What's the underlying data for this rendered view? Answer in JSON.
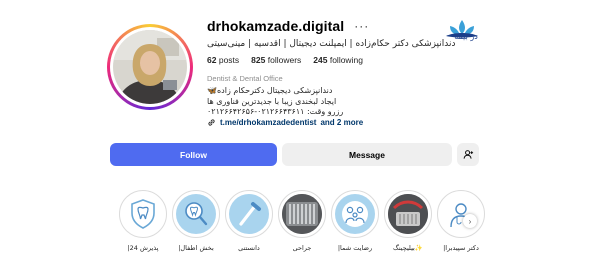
{
  "watermark": {
    "text": "در بیمه"
  },
  "profile": {
    "username": "drhokamzade.digital",
    "more_label": "···",
    "fullname": "دندانپزشکی دکتر حکام‌زاده | ایمپلنت دیجیتال | اقدسیه | مینی‌سیتی",
    "stats": {
      "posts_count": "62",
      "posts_label": "posts",
      "followers_count": "825",
      "followers_label": "followers",
      "following_count": "245",
      "following_label": "following"
    },
    "category": "Dentist & Dental Office",
    "bio_lines": [
      "دندانپزشکی دیجیتال دکترحکام زاده🦋",
      "ایجاد لبخندی زیبا با جدیدترین فناوری ها",
      "رزرو وقت: ۰۲۱۲۶۶۴۳۶۱۱-۰۲۱۲۶۶۴۲۶۵۶"
    ],
    "link_text": "t.me/drhokamzadedentist",
    "link_more": "and 2 more"
  },
  "actions": {
    "follow_label": "Follow",
    "message_label": "Message",
    "suggest_icon": "person-add-icon"
  },
  "colors": {
    "follow_bg": "#4f6bf0",
    "button_bg": "#efefef",
    "link": "#00376b"
  },
  "highlights": [
    {
      "label": "|پذیرش 24",
      "icon": "tooth-shield-icon"
    },
    {
      "label": "|بخش اطفال",
      "icon": "magnifier-tooth-icon"
    },
    {
      "label": "دانستنی",
      "icon": "toothbrush-icon"
    },
    {
      "label": "جراحی",
      "icon": "dental-tools-photo"
    },
    {
      "label": "|رضایت شما",
      "icon": "family-icon"
    },
    {
      "label": "بیلیچینگ✨",
      "icon": "tools-photo"
    },
    {
      "label": "|دکتر سپیدبرا",
      "icon": "doctor-icon"
    }
  ]
}
